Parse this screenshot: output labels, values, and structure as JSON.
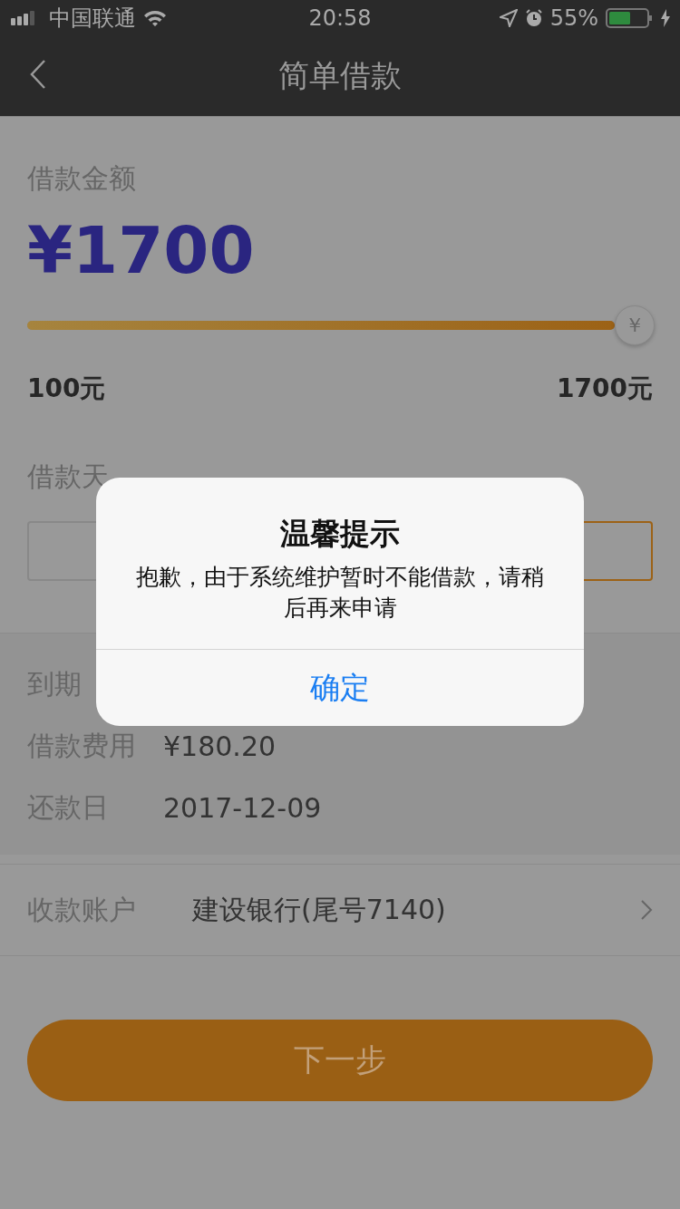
{
  "status_bar": {
    "carrier": "中国联通",
    "time": "20:58",
    "battery": "55%"
  },
  "nav": {
    "title": "简单借款"
  },
  "amount": {
    "label": "借款金额",
    "value": "¥1700"
  },
  "slider": {
    "level": 1,
    "thumb_symbol": "￥",
    "min_label": "100元",
    "max_label": "1700元"
  },
  "days": {
    "label": "借款天",
    "options": [
      {
        "selected": false
      },
      {
        "selected": true
      }
    ]
  },
  "details": [
    {
      "label": "到期"
    },
    {
      "label": "借款费用",
      "value": "¥180.20"
    },
    {
      "label": "还款日",
      "value": "2017-12-09"
    }
  ],
  "account": {
    "label": "收款账户",
    "value": "建设银行(尾号7140)"
  },
  "next_button": {
    "label": "下一步"
  },
  "dialog": {
    "title": "温馨提示",
    "message": "抱歉，由于系统维护暂时不能借款，请稍后再来申请",
    "button": "确定"
  }
}
